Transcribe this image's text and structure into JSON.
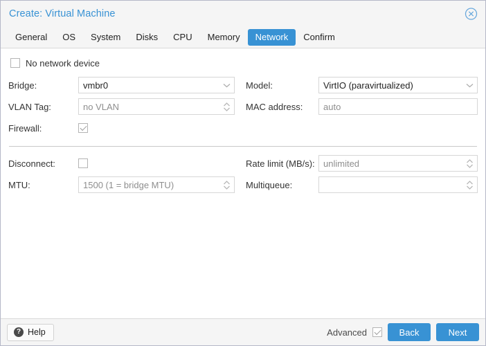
{
  "window": {
    "title": "Create: Virtual Machine",
    "close_icon": "close-circle-icon"
  },
  "tabs": [
    {
      "label": "General",
      "active": false
    },
    {
      "label": "OS",
      "active": false
    },
    {
      "label": "System",
      "active": false
    },
    {
      "label": "Disks",
      "active": false
    },
    {
      "label": "CPU",
      "active": false
    },
    {
      "label": "Memory",
      "active": false
    },
    {
      "label": "Network",
      "active": true
    },
    {
      "label": "Confirm",
      "active": false
    }
  ],
  "form": {
    "no_network_device": {
      "label": "No network device",
      "checked": false
    },
    "basic": {
      "left": [
        {
          "label": "Bridge:",
          "value": "vmbr0",
          "placeholder": "",
          "control": "combobox",
          "name": "bridge"
        },
        {
          "label": "VLAN Tag:",
          "value": "",
          "placeholder": "no VLAN",
          "control": "spinner",
          "name": "vlan-tag"
        }
      ],
      "firewall": {
        "label": "Firewall:",
        "checked": true
      },
      "right": [
        {
          "label": "Model:",
          "value": "VirtIO (paravirtualized)",
          "placeholder": "",
          "control": "combobox",
          "name": "model"
        },
        {
          "label": "MAC address:",
          "value": "",
          "placeholder": "auto",
          "control": "text",
          "name": "mac-address"
        }
      ]
    },
    "advanced": {
      "disconnect": {
        "label": "Disconnect:",
        "checked": false
      },
      "left": [
        {
          "label": "MTU:",
          "value": "",
          "placeholder": "1500 (1 = bridge MTU)",
          "control": "spinner",
          "name": "mtu"
        }
      ],
      "right": [
        {
          "label": "Rate limit (MB/s):",
          "value": "",
          "placeholder": "unlimited",
          "control": "spinner",
          "name": "rate-limit"
        },
        {
          "label": "Multiqueue:",
          "value": "",
          "placeholder": "",
          "control": "spinner",
          "name": "multiqueue"
        }
      ]
    }
  },
  "footer": {
    "help_label": "Help",
    "help_icon": "question-mark-icon",
    "advanced_label": "Advanced",
    "advanced_checked": true,
    "back_label": "Back",
    "next_label": "Next"
  },
  "colors": {
    "accent": "#3892d4",
    "header_bg": "#f5f5f5",
    "text": "#333333",
    "placeholder": "#8e8e8e"
  }
}
